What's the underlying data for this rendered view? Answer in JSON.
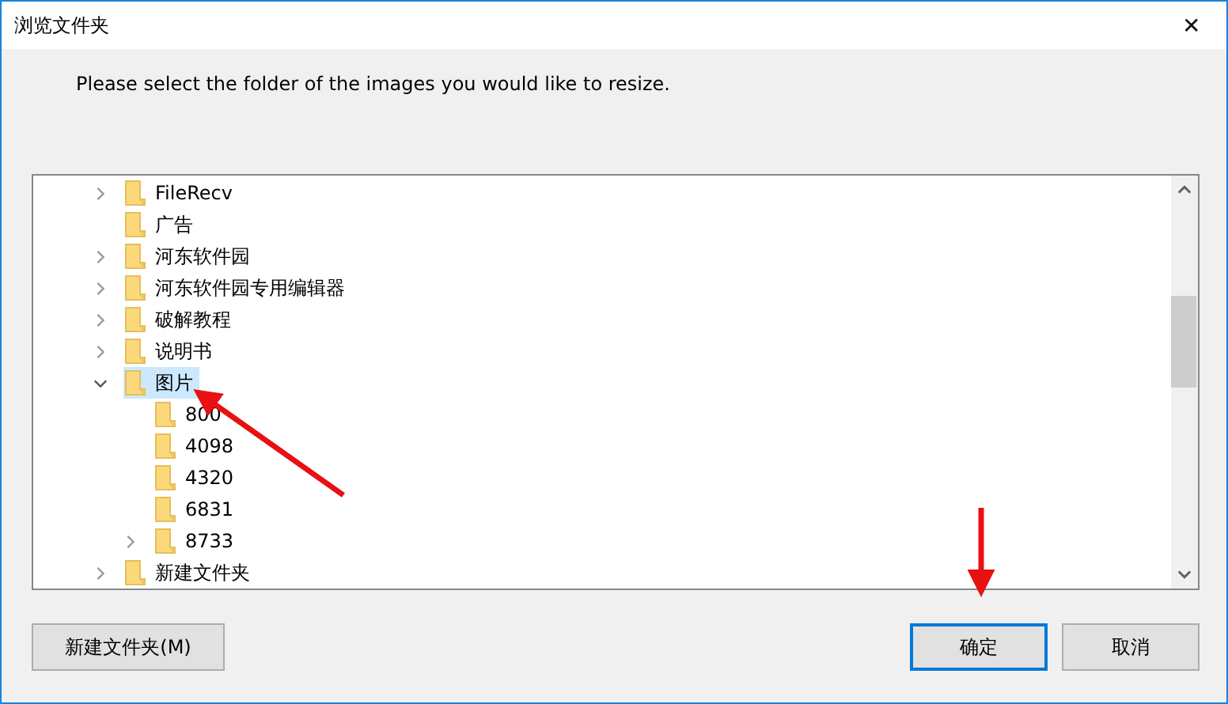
{
  "window": {
    "title": "浏览文件夹",
    "close": "✕"
  },
  "instruction": "Please select the folder of the images you would like to resize.",
  "tree": [
    {
      "label": "FileRecv",
      "expanded": false,
      "selected": false
    },
    {
      "label": "广告",
      "selected": false
    },
    {
      "label": "河东软件园",
      "expanded": false,
      "selected": false
    },
    {
      "label": "河东软件园专用编辑器",
      "expanded": false,
      "selected": false
    },
    {
      "label": "破解教程",
      "expanded": false,
      "selected": false
    },
    {
      "label": "说明书",
      "expanded": false,
      "selected": false
    },
    {
      "label": "图片",
      "expanded": true,
      "selected": true,
      "children": [
        {
          "label": "800",
          "selected": false
        },
        {
          "label": "4098",
          "selected": false
        },
        {
          "label": "4320",
          "selected": false
        },
        {
          "label": "6831",
          "selected": false
        },
        {
          "label": "8733",
          "expanded": false,
          "selected": false
        }
      ]
    },
    {
      "label": "新建文件夹",
      "expanded": false,
      "selected": false
    }
  ],
  "buttons": {
    "new_folder": "新建文件夹(M)",
    "ok": "确定",
    "cancel": "取消"
  }
}
